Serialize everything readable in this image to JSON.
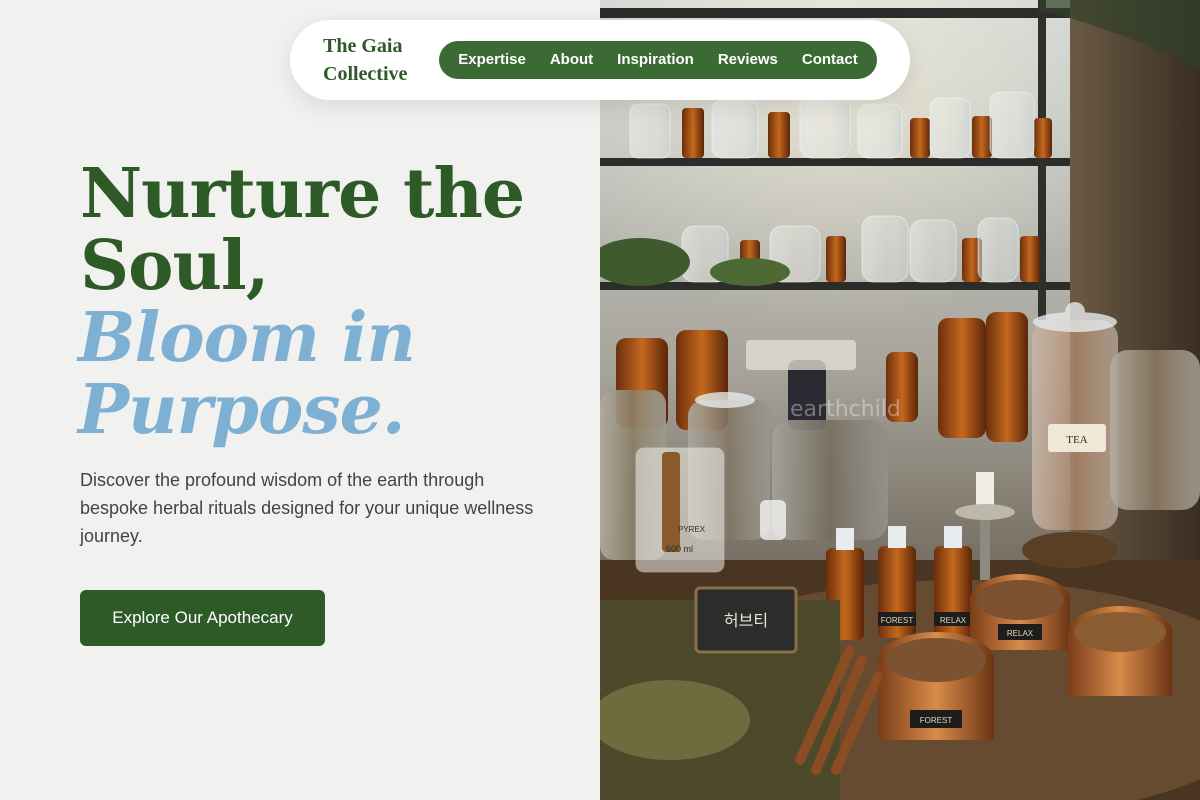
{
  "brand": {
    "name_line1": "The Gaia",
    "name_line2": "Collective"
  },
  "nav": {
    "items": [
      {
        "label": "Expertise"
      },
      {
        "label": "About"
      },
      {
        "label": "Inspiration"
      },
      {
        "label": "Reviews"
      },
      {
        "label": "Contact"
      }
    ]
  },
  "hero": {
    "title_line1": "Nurture the",
    "title_line2": "Soul,",
    "accent_line1": "Bloom in",
    "accent_line2": "Purpose.",
    "description": "Discover the profound wisdom of the earth through bespoke herbal rituals designed for your unique wellness journey.",
    "cta_label": "Explore Our Apothecary"
  },
  "photo": {
    "watermark": "earthchild",
    "labels": {
      "beaker_brand": "PYREX",
      "beaker_volume": "600 ml",
      "chalk_sign": "허브티",
      "jar_label": "TEA",
      "tin_label_1": "RELAX",
      "tin_label_2": "FOREST",
      "bottle_label_1": "FOREST",
      "bottle_label_2": "RELAX"
    }
  },
  "colors": {
    "background": "#f1f2ef",
    "brand_green": "#2d5a27",
    "menu_green": "#3b6a34",
    "accent_blue": "#7eb0d4",
    "body_text": "#3f4449"
  }
}
